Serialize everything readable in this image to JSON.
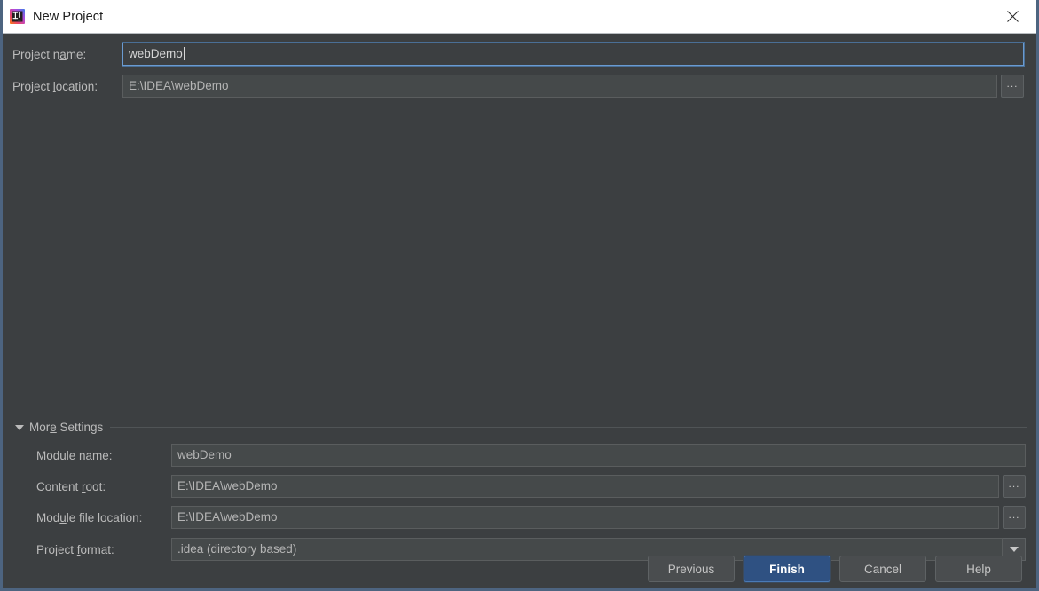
{
  "window": {
    "title": "New Project",
    "app_icon": "intellij-idea-icon",
    "close_icon": "close-icon",
    "frame_color": "#4d6480",
    "background_color": "#3c3f41",
    "titlebar_color": "#ffffff"
  },
  "main": {
    "project_name": {
      "label_pre": "Project n",
      "label_mnemonic": "a",
      "label_post": "me:",
      "value": "webDemo",
      "placeholder": "",
      "focused": true
    },
    "project_location": {
      "label_pre": "Project ",
      "label_mnemonic": "l",
      "label_post": "ocation:",
      "value": "E:\\IDEA\\webDemo",
      "placeholder": "",
      "browse_label": "..."
    }
  },
  "more_settings": {
    "label_pre": "Mor",
    "label_mnemonic": "e",
    "label_post": " Settings",
    "expanded": true,
    "collapse_icon": "triangle-down-icon",
    "fields": {
      "module_name": {
        "label_pre": "Module na",
        "label_mnemonic": "m",
        "label_post": "e:",
        "value": "webDemo"
      },
      "content_root": {
        "label_pre": "Content ",
        "label_mnemonic": "r",
        "label_post": "oot:",
        "value": "E:\\IDEA\\webDemo",
        "browse_label": "..."
      },
      "module_file_location": {
        "label_pre": "Mod",
        "label_mnemonic": "u",
        "label_post": "le file location:",
        "value": "E:\\IDEA\\webDemo",
        "browse_label": "..."
      },
      "project_format": {
        "label_pre": "Project ",
        "label_mnemonic": "f",
        "label_post": "ormat:",
        "value": ".idea (directory based)",
        "dropdown_icon": "chevron-down-icon"
      }
    }
  },
  "buttons": {
    "previous": "Previous",
    "finish": "Finish",
    "cancel": "Cancel",
    "help": "Help",
    "default_button_color": "#2f5182"
  }
}
